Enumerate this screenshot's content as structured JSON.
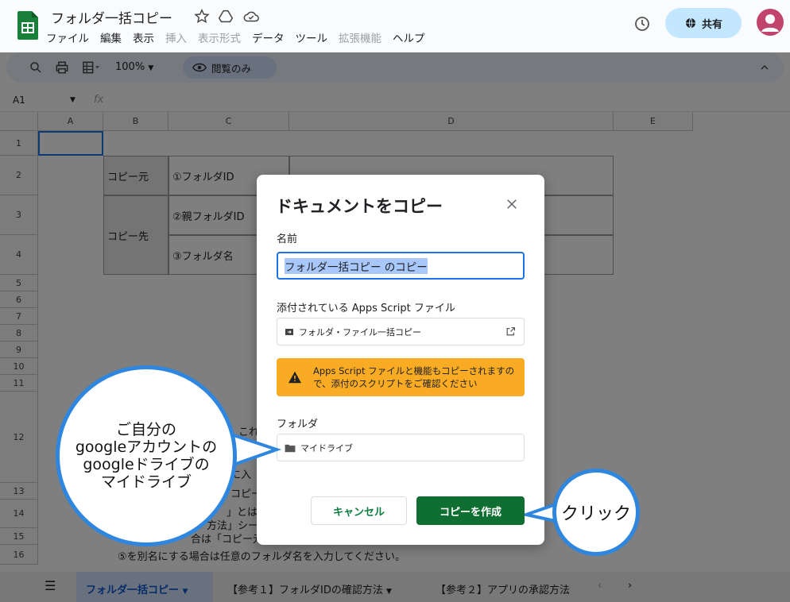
{
  "app": {
    "title": "フォルダ一括コピー"
  },
  "menu": [
    "ファイル",
    "編集",
    "表示",
    "挿入",
    "表示形式",
    "データ",
    "ツール",
    "拡張機能",
    "ヘルプ"
  ],
  "menu_disabled": [
    false,
    false,
    false,
    true,
    true,
    false,
    false,
    true,
    false
  ],
  "share": {
    "label": "共有"
  },
  "toolbar": {
    "zoom": "100%",
    "view_only": "閲覧のみ"
  },
  "formula": {
    "cell_ref": "A1",
    "fx": "fx"
  },
  "grid": {
    "columns": [
      "A",
      "B",
      "C",
      "D",
      "E"
    ],
    "rows": [
      "1",
      "2",
      "3",
      "4",
      "5",
      "6",
      "7",
      "8",
      "9",
      "10",
      "11",
      "12",
      "13",
      "14",
      "15",
      "16"
    ],
    "b2": "コピー元",
    "c2": "①フォルダID",
    "b3": "コピー先",
    "c3": "②親フォルダID",
    "c4": "③フォルダ名",
    "bg_text": [
      "これ",
      "に入",
      "コピー",
      "」とは",
      "方法」シー",
      "合は「コピー元",
      "⑤を別名にする場合は任意のフォルダ名を入力してください。"
    ]
  },
  "dialog": {
    "title": "ドキュメントをコピー",
    "name_label": "名前",
    "name_value": "フォルダ一括コピー のコピー",
    "script_label": "添付されている Apps Script ファイル",
    "script_file": "フォルダ・ファイル一括コピー",
    "warning": "Apps Script ファイルと機能もコピーされますので、添付のスクリプトをご確認ください",
    "folder_label": "フォルダ",
    "folder_value": "マイドライブ",
    "cancel": "キャンセル",
    "create": "コピーを作成"
  },
  "callouts": {
    "folder_note": "ご自分の\ngoogleアカウントの\ngoogleドライブの\nマイドライブ",
    "click_note": "クリック"
  },
  "tabs": [
    "フォルダ一括コピー",
    "【参考１】フォルダIDの確認方法",
    "【参考２】アプリの承認方法"
  ],
  "colors": {
    "accent": "#1a73e8",
    "primary_button": "#0f6f32",
    "warning": "#f9ab24",
    "callout_border": "#2e86de"
  }
}
